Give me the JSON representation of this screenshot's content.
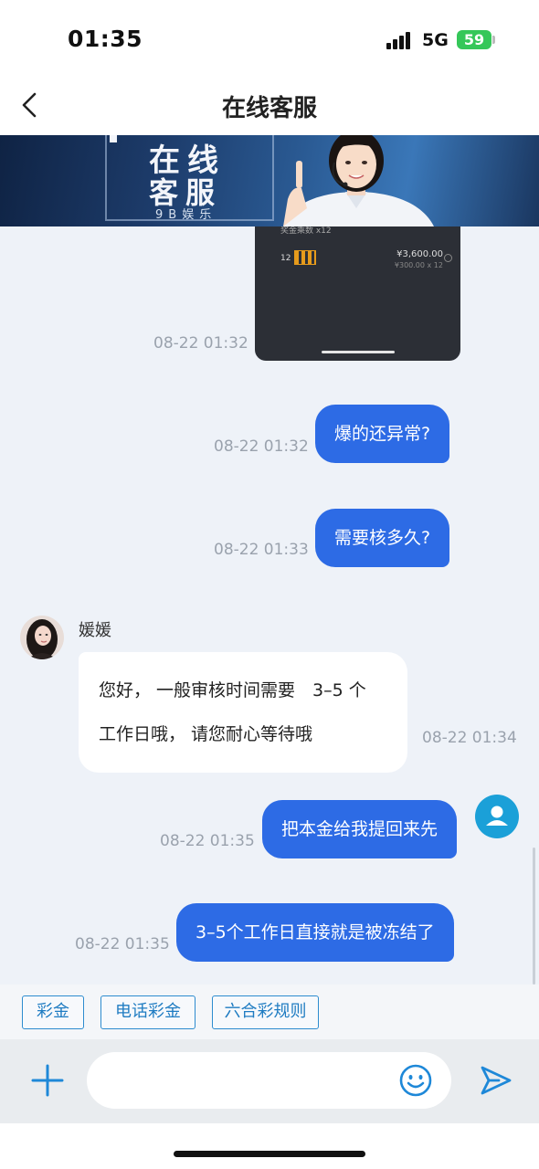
{
  "status_bar": {
    "time": "01:35",
    "network": "5G",
    "battery": "59"
  },
  "nav": {
    "title": "在线客服"
  },
  "banner": {
    "title_line1": "在线",
    "title_line2": "客服",
    "subtitle": "9B娱乐"
  },
  "screenshot_preview": {
    "caption": "奖金乘数 x12",
    "row_number": "12",
    "amount": "¥3,600.00",
    "amount_detail": "¥300.00 x 12"
  },
  "messages": [
    {
      "id": "m0",
      "direction": "out",
      "type": "image",
      "time": "08-22 01:32"
    },
    {
      "id": "m1",
      "direction": "out",
      "type": "text",
      "text": "爆的还异常?",
      "time": "08-22 01:32"
    },
    {
      "id": "m2",
      "direction": "out",
      "type": "text",
      "text": "需要核多久?",
      "time": "08-22 01:33"
    },
    {
      "id": "m3",
      "direction": "in",
      "type": "text",
      "sender": "媛媛",
      "lines": [
        "您好， 一般审核时间需要　3–5 个",
        "工作日哦， 请您耐心等待哦"
      ],
      "time": "08-22 01:34"
    },
    {
      "id": "m4",
      "direction": "out",
      "type": "text",
      "text": "把本金给我提回来先",
      "time": "08-22 01:35"
    },
    {
      "id": "m5",
      "direction": "out",
      "type": "text",
      "text": "3–5个工作日直接就是被冻结了",
      "time": "08-22 01:35"
    }
  ],
  "quick_replies": [
    "彩金",
    "电话彩金",
    "六合彩规则"
  ],
  "input": {
    "placeholder": ""
  },
  "icons": {
    "back": "chevron-left-icon",
    "add": "plus-icon",
    "emoji": "smiley-icon",
    "send": "send-icon",
    "user": "user-icon"
  },
  "colors": {
    "accent": "#2d6be5",
    "quick_reply": "#2d8ccf",
    "battery": "#35c759"
  }
}
